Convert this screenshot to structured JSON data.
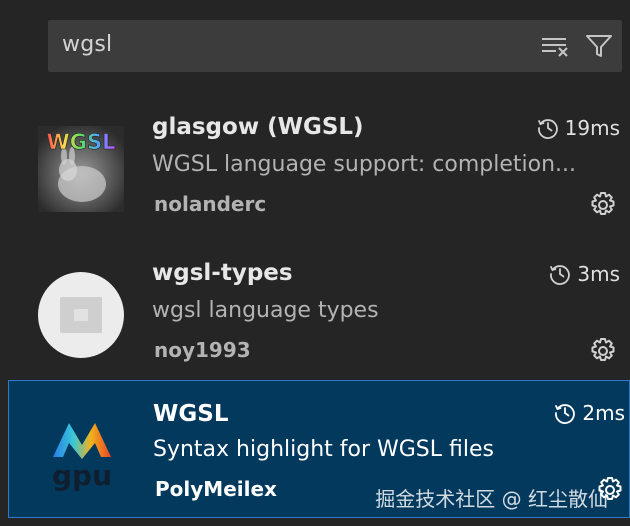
{
  "search": {
    "value": "wgsl",
    "clear_icon": "clear-filter-icon",
    "filter_icon": "filter-icon"
  },
  "extensions": [
    {
      "name": "glasgow (WGSL)",
      "description": "WGSL language support: completion...",
      "publisher": "nolanderc",
      "time": "19ms",
      "icon_text": "WGSL",
      "selected": false
    },
    {
      "name": "wgsl-types",
      "description": "wgsl language types",
      "publisher": "noy1993",
      "time": "3ms",
      "selected": false
    },
    {
      "name": "WGSL",
      "description": "Syntax highlight for WGSL files",
      "publisher": "PolyMeilex",
      "time": "2ms",
      "icon_text": "gpu",
      "selected": true
    }
  ],
  "watermark": "掘金技术社区 @ 红尘散仙",
  "colors": {
    "background": "#252526",
    "search_bg": "#3c3c3c",
    "selected_bg": "#04395e",
    "selected_border": "#2f78c8"
  }
}
